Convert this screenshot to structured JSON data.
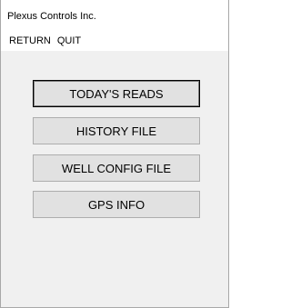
{
  "window": {
    "title": "Plexus Controls Inc."
  },
  "menu": {
    "items": [
      {
        "label": "RETURN"
      },
      {
        "label": "QUIT"
      }
    ]
  },
  "buttons": [
    {
      "label": "TODAY'S READS"
    },
    {
      "label": "HISTORY FILE"
    },
    {
      "label": "WELL CONFIG FILE"
    },
    {
      "label": "GPS INFO"
    }
  ]
}
